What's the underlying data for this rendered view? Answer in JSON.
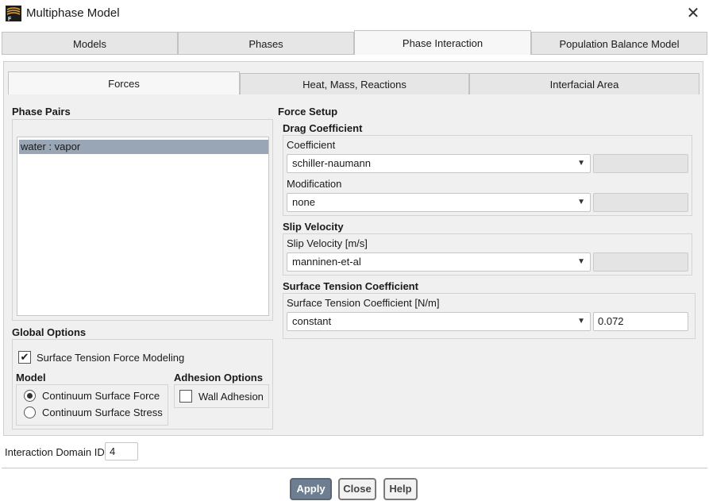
{
  "window": {
    "title": "Multiphase Model",
    "close_glyph": "✕"
  },
  "top_tabs": [
    {
      "label": "Models",
      "active": false
    },
    {
      "label": "Phases",
      "active": false
    },
    {
      "label": "Phase Interaction",
      "active": true
    },
    {
      "label": "Population Balance Model",
      "active": false
    }
  ],
  "sub_tabs": [
    {
      "label": "Forces",
      "active": true
    },
    {
      "label": "Heat, Mass, Reactions",
      "active": false
    },
    {
      "label": "Interfacial Area",
      "active": false
    }
  ],
  "phase_pairs": {
    "title": "Phase Pairs",
    "items": [
      {
        "label": "water : vapor",
        "selected": true
      }
    ]
  },
  "global_options": {
    "title": "Global Options",
    "surface_tension_modeling": {
      "label": "Surface Tension Force Modeling",
      "checked": true
    },
    "model": {
      "title": "Model",
      "options": [
        {
          "label": "Continuum Surface Force",
          "selected": true
        },
        {
          "label": "Continuum Surface Stress",
          "selected": false
        }
      ]
    },
    "adhesion": {
      "title": "Adhesion Options",
      "wall_adhesion": {
        "label": "Wall Adhesion",
        "checked": false
      }
    }
  },
  "force_setup": {
    "title": "Force Setup",
    "drag": {
      "title": "Drag Coefficient",
      "coefficient_label": "Coefficient",
      "coefficient_value": "schiller-naumann",
      "coefficient_text": "",
      "modification_label": "Modification",
      "modification_value": "none",
      "modification_text": ""
    },
    "slip": {
      "title": "Slip Velocity",
      "label": "Slip Velocity [m/s]",
      "value": "manninen-et-al",
      "text": ""
    },
    "surface_tension": {
      "title": "Surface Tension Coefficient",
      "label": "Surface Tension Coefficient [N/m]",
      "value": "constant",
      "text": "0.072"
    }
  },
  "interaction_domain": {
    "label": "Interaction Domain ID",
    "value": "4"
  },
  "buttons": {
    "apply": "Apply",
    "close": "Close",
    "help": "Help"
  },
  "colors": {
    "selection": "#98a6b6",
    "primary_button": "#6e7e91",
    "panel": "#f0f0f0"
  }
}
